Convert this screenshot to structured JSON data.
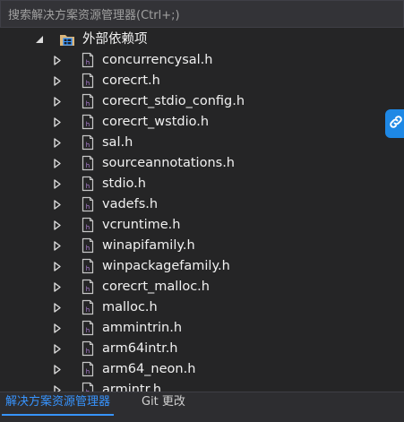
{
  "search": {
    "placeholder": "搜索解决方案资源管理器(Ctrl+;)"
  },
  "tree": {
    "root": {
      "label": "外部依赖项",
      "expanded": true,
      "icon": "external-dependencies-folder-icon"
    },
    "items": [
      {
        "label": "concurrencysal.h"
      },
      {
        "label": "corecrt.h"
      },
      {
        "label": "corecrt_stdio_config.h"
      },
      {
        "label": "corecrt_wstdio.h"
      },
      {
        "label": "sal.h"
      },
      {
        "label": "sourceannotations.h"
      },
      {
        "label": "stdio.h"
      },
      {
        "label": "vadefs.h"
      },
      {
        "label": "vcruntime.h"
      },
      {
        "label": "winapifamily.h"
      },
      {
        "label": "winpackagefamily.h"
      },
      {
        "label": "corecrt_malloc.h"
      },
      {
        "label": "malloc.h"
      },
      {
        "label": "ammintrin.h"
      },
      {
        "label": "arm64intr.h"
      },
      {
        "label": "arm64_neon.h"
      },
      {
        "label": "armintr.h"
      }
    ]
  },
  "bottom_tabs": [
    {
      "label": "解决方案资源管理器",
      "active": true
    },
    {
      "label": "Git 更改",
      "active": false
    }
  ],
  "colors": {
    "accent": "#3794ff",
    "background": "#252526",
    "floating_button": "#1e88e5"
  }
}
